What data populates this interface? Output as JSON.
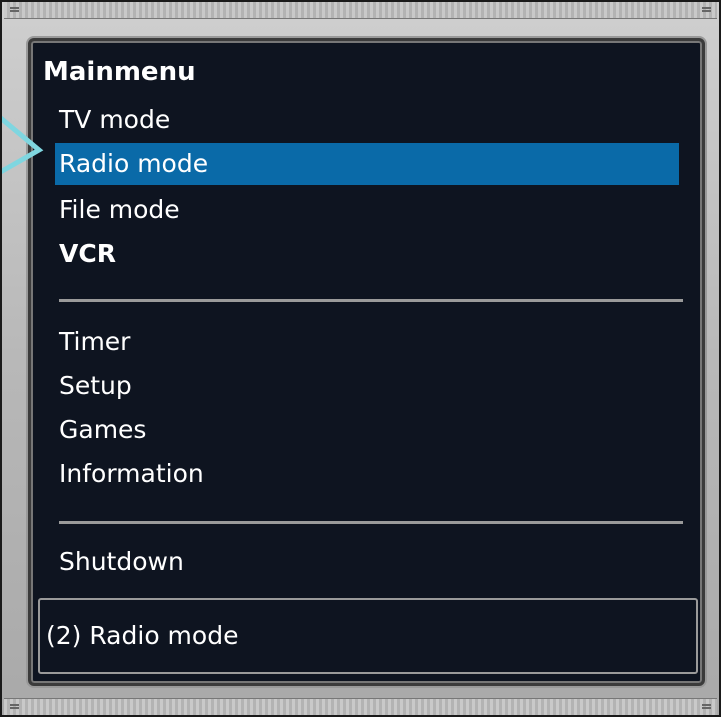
{
  "panel": {
    "title": "Mainmenu"
  },
  "menu": {
    "items": [
      {
        "label": "TV mode"
      },
      {
        "label": "Radio mode"
      },
      {
        "label": "File mode"
      },
      {
        "label": "VCR"
      },
      {
        "label": "Timer"
      },
      {
        "label": "Setup"
      },
      {
        "label": "Games"
      },
      {
        "label": "Information"
      },
      {
        "label": "Shutdown"
      }
    ],
    "selected_index": 1
  },
  "status": {
    "text": "(2) Radio mode"
  },
  "colors": {
    "panel_background": "#0e1420",
    "selection": "#0a6aa8",
    "text": "#ffffff",
    "arrow": "#7fd6e0"
  }
}
